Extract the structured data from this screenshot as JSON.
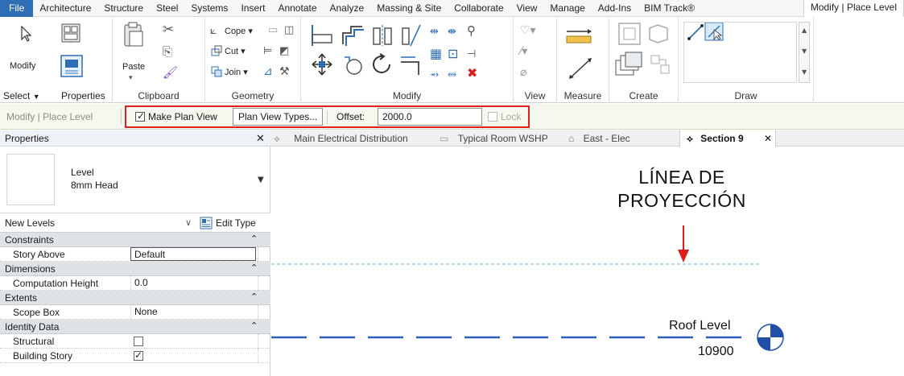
{
  "menu": {
    "file": "File",
    "tabs": [
      "Architecture",
      "Structure",
      "Steel",
      "Systems",
      "Insert",
      "Annotate",
      "Analyze",
      "Massing & Site",
      "Collaborate",
      "View",
      "Manage",
      "Add-Ins",
      "BIM Track®"
    ],
    "active_tab": "Modify | Place Level"
  },
  "ribbon": {
    "select_panel": {
      "modify": "Modify",
      "select": "Select",
      "properties": "Properties"
    },
    "clipboard_panel": {
      "label": "Clipboard",
      "paste": "Paste"
    },
    "geometry_panel": {
      "label": "Geometry",
      "cope": "Cope",
      "cut": "Cut",
      "join": "Join"
    },
    "modify_panel": {
      "label": "Modify"
    },
    "view_panel": {
      "label": "View"
    },
    "measure_panel": {
      "label": "Measure"
    },
    "create_panel": {
      "label": "Create"
    },
    "draw_panel": {
      "label": "Draw"
    }
  },
  "options_bar": {
    "context": "Modify | Place Level",
    "make_plan_view": "Make Plan View",
    "make_plan_view_checked": true,
    "plan_view_types": "Plan View Types...",
    "offset_label": "Offset:",
    "offset_value": "2000.0",
    "lock": "Lock",
    "lock_checked": false
  },
  "properties": {
    "title": "Properties",
    "close": "✕",
    "type_family": "Level",
    "type_name": "8mm Head",
    "filter": "New Levels",
    "edit_type": "Edit Type",
    "groups": [
      {
        "name": "Constraints",
        "rows": [
          {
            "key": "Story Above",
            "value": "Default"
          }
        ]
      },
      {
        "name": "Dimensions",
        "rows": [
          {
            "key": "Computation Height",
            "value": "0.0"
          }
        ]
      },
      {
        "name": "Extents",
        "rows": [
          {
            "key": "Scope Box",
            "value": "None"
          }
        ]
      },
      {
        "name": "Identity Data",
        "rows": [
          {
            "key": "Structural",
            "checked": false
          },
          {
            "key": "Building Story",
            "checked": true
          }
        ]
      }
    ]
  },
  "view_tabs": [
    {
      "label": "Main Electrical Distribution"
    },
    {
      "label": "Typical Room WSHP"
    },
    {
      "label": "East - Elec"
    },
    {
      "label": "Section 9",
      "active": true
    }
  ],
  "canvas": {
    "annotation": [
      "LÍNEA DE",
      "PROYECCIÓN"
    ],
    "level_name": "Roof Level",
    "level_elevation": "10900",
    "colors": {
      "projection_line": "#9fc9e8",
      "level_line": "#2a5fb8",
      "arrow": "#e01b1b",
      "head": "#1f4fa8"
    }
  }
}
